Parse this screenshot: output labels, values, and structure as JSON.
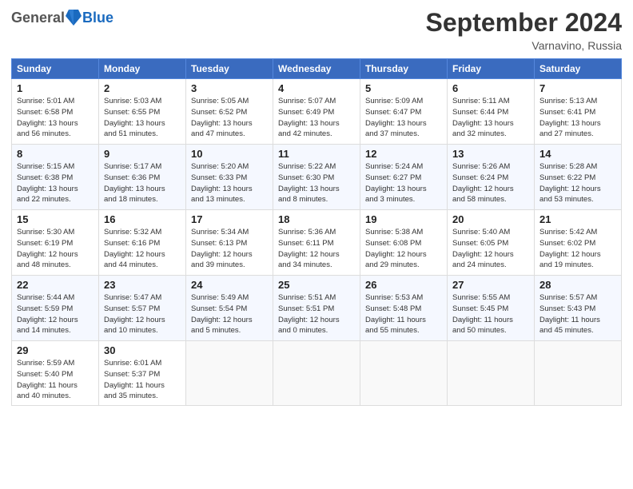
{
  "header": {
    "logo_general": "General",
    "logo_blue": "Blue",
    "month_title": "September 2024",
    "location": "Varnavino, Russia"
  },
  "weekdays": [
    "Sunday",
    "Monday",
    "Tuesday",
    "Wednesday",
    "Thursday",
    "Friday",
    "Saturday"
  ],
  "weeks": [
    [
      {
        "day": "1",
        "info": "Sunrise: 5:01 AM\nSunset: 6:58 PM\nDaylight: 13 hours\nand 56 minutes."
      },
      {
        "day": "2",
        "info": "Sunrise: 5:03 AM\nSunset: 6:55 PM\nDaylight: 13 hours\nand 51 minutes."
      },
      {
        "day": "3",
        "info": "Sunrise: 5:05 AM\nSunset: 6:52 PM\nDaylight: 13 hours\nand 47 minutes."
      },
      {
        "day": "4",
        "info": "Sunrise: 5:07 AM\nSunset: 6:49 PM\nDaylight: 13 hours\nand 42 minutes."
      },
      {
        "day": "5",
        "info": "Sunrise: 5:09 AM\nSunset: 6:47 PM\nDaylight: 13 hours\nand 37 minutes."
      },
      {
        "day": "6",
        "info": "Sunrise: 5:11 AM\nSunset: 6:44 PM\nDaylight: 13 hours\nand 32 minutes."
      },
      {
        "day": "7",
        "info": "Sunrise: 5:13 AM\nSunset: 6:41 PM\nDaylight: 13 hours\nand 27 minutes."
      }
    ],
    [
      {
        "day": "8",
        "info": "Sunrise: 5:15 AM\nSunset: 6:38 PM\nDaylight: 13 hours\nand 22 minutes."
      },
      {
        "day": "9",
        "info": "Sunrise: 5:17 AM\nSunset: 6:36 PM\nDaylight: 13 hours\nand 18 minutes."
      },
      {
        "day": "10",
        "info": "Sunrise: 5:20 AM\nSunset: 6:33 PM\nDaylight: 13 hours\nand 13 minutes."
      },
      {
        "day": "11",
        "info": "Sunrise: 5:22 AM\nSunset: 6:30 PM\nDaylight: 13 hours\nand 8 minutes."
      },
      {
        "day": "12",
        "info": "Sunrise: 5:24 AM\nSunset: 6:27 PM\nDaylight: 13 hours\nand 3 minutes."
      },
      {
        "day": "13",
        "info": "Sunrise: 5:26 AM\nSunset: 6:24 PM\nDaylight: 12 hours\nand 58 minutes."
      },
      {
        "day": "14",
        "info": "Sunrise: 5:28 AM\nSunset: 6:22 PM\nDaylight: 12 hours\nand 53 minutes."
      }
    ],
    [
      {
        "day": "15",
        "info": "Sunrise: 5:30 AM\nSunset: 6:19 PM\nDaylight: 12 hours\nand 48 minutes."
      },
      {
        "day": "16",
        "info": "Sunrise: 5:32 AM\nSunset: 6:16 PM\nDaylight: 12 hours\nand 44 minutes."
      },
      {
        "day": "17",
        "info": "Sunrise: 5:34 AM\nSunset: 6:13 PM\nDaylight: 12 hours\nand 39 minutes."
      },
      {
        "day": "18",
        "info": "Sunrise: 5:36 AM\nSunset: 6:11 PM\nDaylight: 12 hours\nand 34 minutes."
      },
      {
        "day": "19",
        "info": "Sunrise: 5:38 AM\nSunset: 6:08 PM\nDaylight: 12 hours\nand 29 minutes."
      },
      {
        "day": "20",
        "info": "Sunrise: 5:40 AM\nSunset: 6:05 PM\nDaylight: 12 hours\nand 24 minutes."
      },
      {
        "day": "21",
        "info": "Sunrise: 5:42 AM\nSunset: 6:02 PM\nDaylight: 12 hours\nand 19 minutes."
      }
    ],
    [
      {
        "day": "22",
        "info": "Sunrise: 5:44 AM\nSunset: 5:59 PM\nDaylight: 12 hours\nand 14 minutes."
      },
      {
        "day": "23",
        "info": "Sunrise: 5:47 AM\nSunset: 5:57 PM\nDaylight: 12 hours\nand 10 minutes."
      },
      {
        "day": "24",
        "info": "Sunrise: 5:49 AM\nSunset: 5:54 PM\nDaylight: 12 hours\nand 5 minutes."
      },
      {
        "day": "25",
        "info": "Sunrise: 5:51 AM\nSunset: 5:51 PM\nDaylight: 12 hours\nand 0 minutes."
      },
      {
        "day": "26",
        "info": "Sunrise: 5:53 AM\nSunset: 5:48 PM\nDaylight: 11 hours\nand 55 minutes."
      },
      {
        "day": "27",
        "info": "Sunrise: 5:55 AM\nSunset: 5:45 PM\nDaylight: 11 hours\nand 50 minutes."
      },
      {
        "day": "28",
        "info": "Sunrise: 5:57 AM\nSunset: 5:43 PM\nDaylight: 11 hours\nand 45 minutes."
      }
    ],
    [
      {
        "day": "29",
        "info": "Sunrise: 5:59 AM\nSunset: 5:40 PM\nDaylight: 11 hours\nand 40 minutes."
      },
      {
        "day": "30",
        "info": "Sunrise: 6:01 AM\nSunset: 5:37 PM\nDaylight: 11 hours\nand 35 minutes."
      },
      {
        "day": "",
        "info": ""
      },
      {
        "day": "",
        "info": ""
      },
      {
        "day": "",
        "info": ""
      },
      {
        "day": "",
        "info": ""
      },
      {
        "day": "",
        "info": ""
      }
    ]
  ]
}
